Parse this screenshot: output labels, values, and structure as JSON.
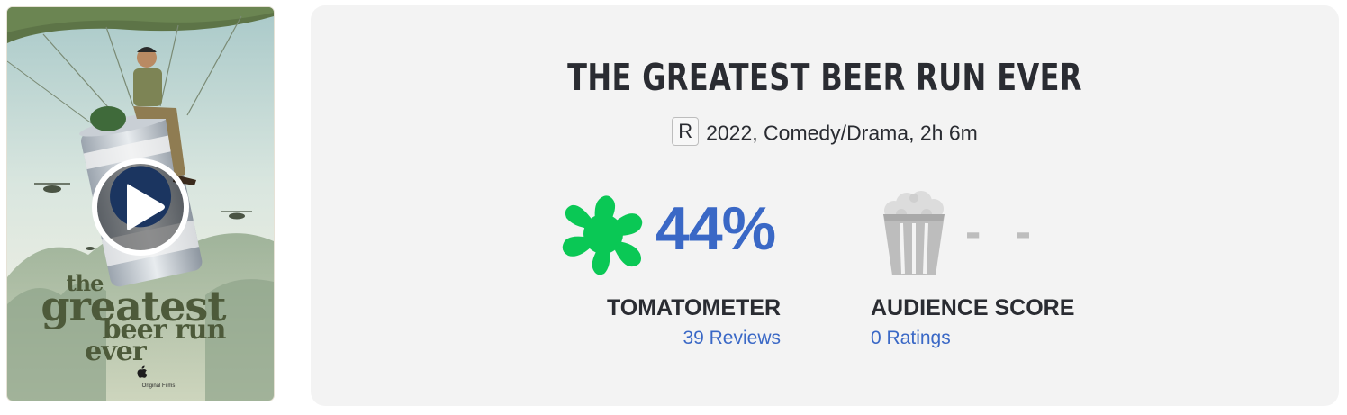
{
  "poster": {
    "title_lines": [
      "the",
      "greatest",
      "beer run",
      "ever"
    ],
    "studio": "Original Films",
    "play_icon": "play-icon",
    "logo_icon": "apple-logo-icon"
  },
  "movie": {
    "title": "THE GREATEST BEER RUN EVER",
    "rating": "R",
    "details": "2022, Comedy/Drama, 2h 6m"
  },
  "tomatometer": {
    "icon": "splat-icon",
    "score": "44%",
    "label": "TOMATOMETER",
    "reviews": "39 Reviews",
    "color": "#0ac855"
  },
  "audience": {
    "icon": "popcorn-bucket-icon",
    "score": "- -",
    "label": "AUDIENCE SCORE",
    "ratings": "0 Ratings"
  },
  "colors": {
    "accent_blue": "#3a68c6",
    "panel_bg": "#f3f3f3",
    "text": "#2a2c32",
    "muted": "#bdbdbd"
  }
}
